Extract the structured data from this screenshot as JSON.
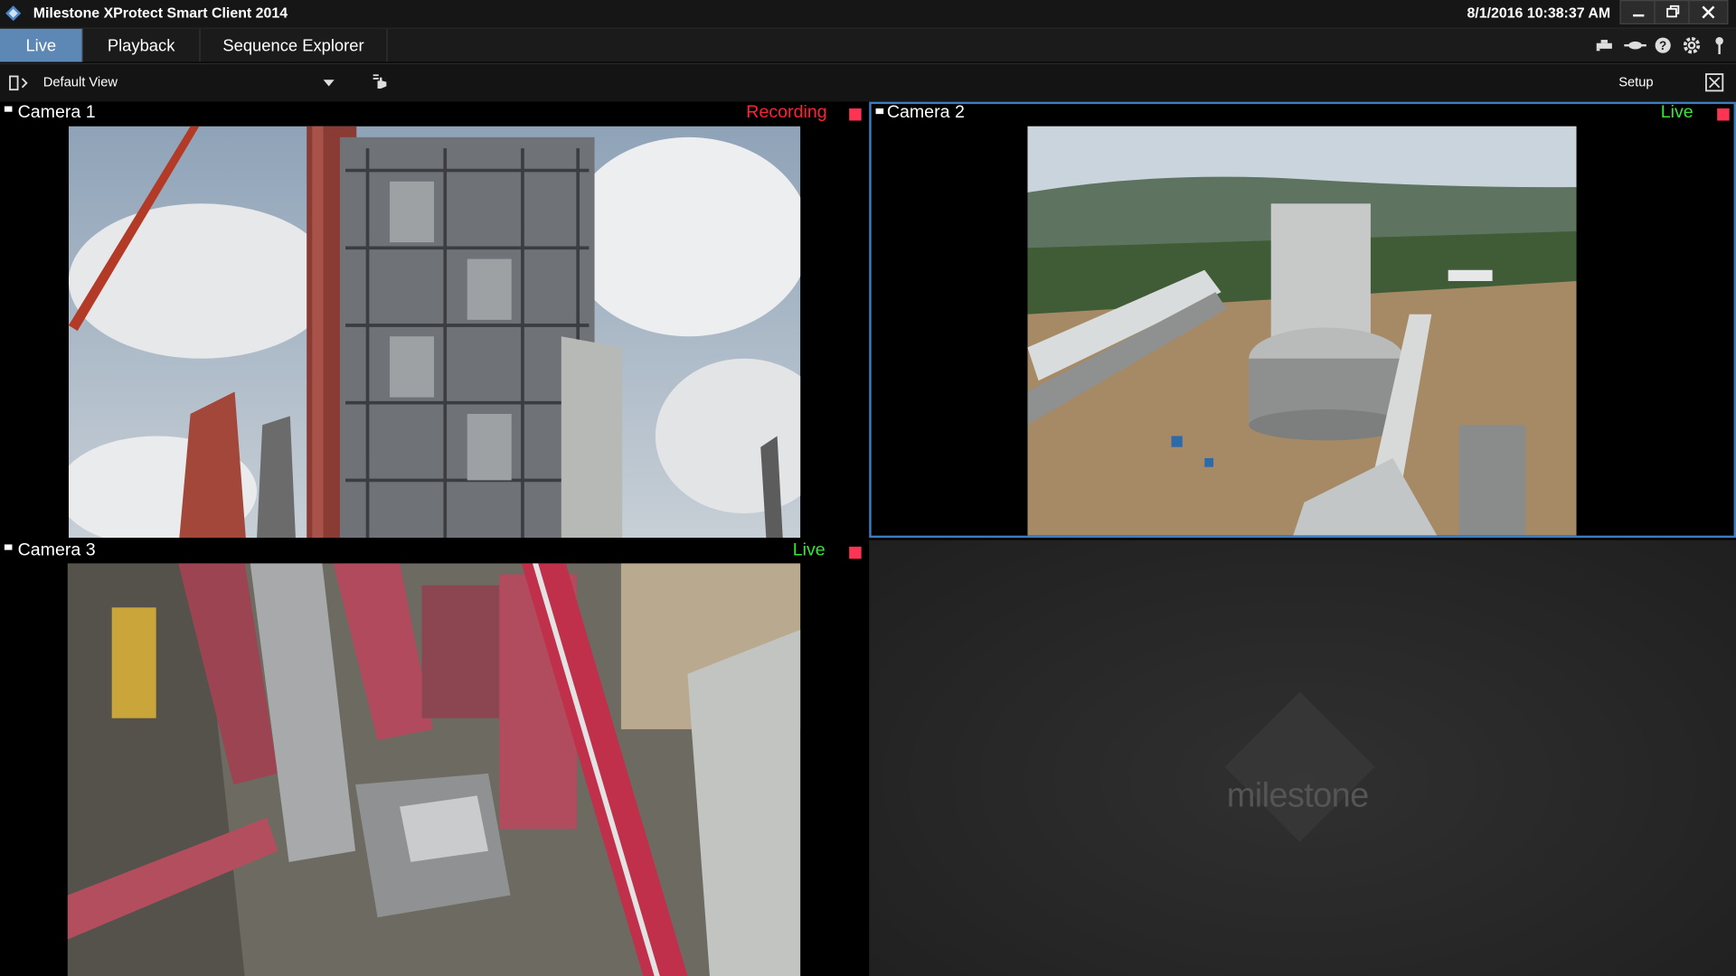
{
  "window": {
    "title": "Milestone XProtect Smart Client 2014",
    "datetime": "8/1/2016 10:38:37 AM",
    "buttons": [
      "minimize-icon",
      "restore-icon",
      "close-icon"
    ]
  },
  "tabs": [
    {
      "label": "Live",
      "active": true
    },
    {
      "label": "Playback",
      "active": false
    },
    {
      "label": "Sequence Explorer",
      "active": false
    }
  ],
  "header_icons": [
    "network-icon",
    "disconnect-icon",
    "help-icon",
    "settings-icon",
    "pin-icon"
  ],
  "toolbar": {
    "view_name": "Default View",
    "setup_label": "Setup",
    "icons": [
      "panel-toggle-icon",
      "chevron-down-icon",
      "hand-cursor-icon",
      "fullscreen-icon"
    ]
  },
  "cameras": [
    {
      "name": "Camera 1",
      "status": "Recording",
      "status_color": "#ff2233",
      "indicator_color": "#ff3354",
      "selected": false
    },
    {
      "name": "Camera 2",
      "status": "Live",
      "status_color": "#39e639",
      "indicator_color": "#ff3354",
      "selected": true
    },
    {
      "name": "Camera 3",
      "status": "Live",
      "status_color": "#39e639",
      "indicator_color": "#ff3354",
      "selected": false
    }
  ],
  "watermark": "milestone",
  "colors": {
    "accent": "#5d87b4",
    "selection": "#3b7dbf"
  }
}
